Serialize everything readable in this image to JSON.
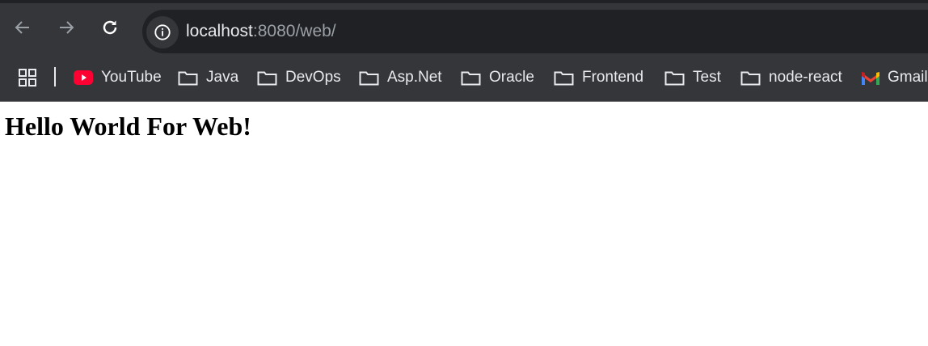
{
  "browser": {
    "address_bar": {
      "host": "localhost",
      "rest": ":8080/web/"
    },
    "icons": {
      "back": "arrow-left-icon",
      "forward": "arrow-right-icon",
      "reload": "reload-icon",
      "site_info": "info-icon",
      "apps": "apps-grid-icon"
    },
    "bookmarks": [
      {
        "label": "YouTube",
        "icon": "youtube-icon"
      },
      {
        "label": "Java",
        "icon": "folder-icon"
      },
      {
        "label": "DevOps",
        "icon": "folder-icon"
      },
      {
        "label": "Asp.Net",
        "icon": "folder-icon"
      },
      {
        "label": "Oracle",
        "icon": "folder-icon"
      },
      {
        "label": "Frontend",
        "icon": "folder-icon"
      },
      {
        "label": "Test",
        "icon": "folder-icon"
      },
      {
        "label": "node-react",
        "icon": "folder-icon"
      },
      {
        "label": "Gmail",
        "icon": "gmail-icon"
      }
    ],
    "colors": {
      "frame": "#35363a",
      "omnibox": "#202124",
      "text": "#e8eaed",
      "muted_text": "#9aa0a6",
      "youtube_red": "#ff0000"
    }
  },
  "page": {
    "heading": "Hello World For Web!"
  }
}
